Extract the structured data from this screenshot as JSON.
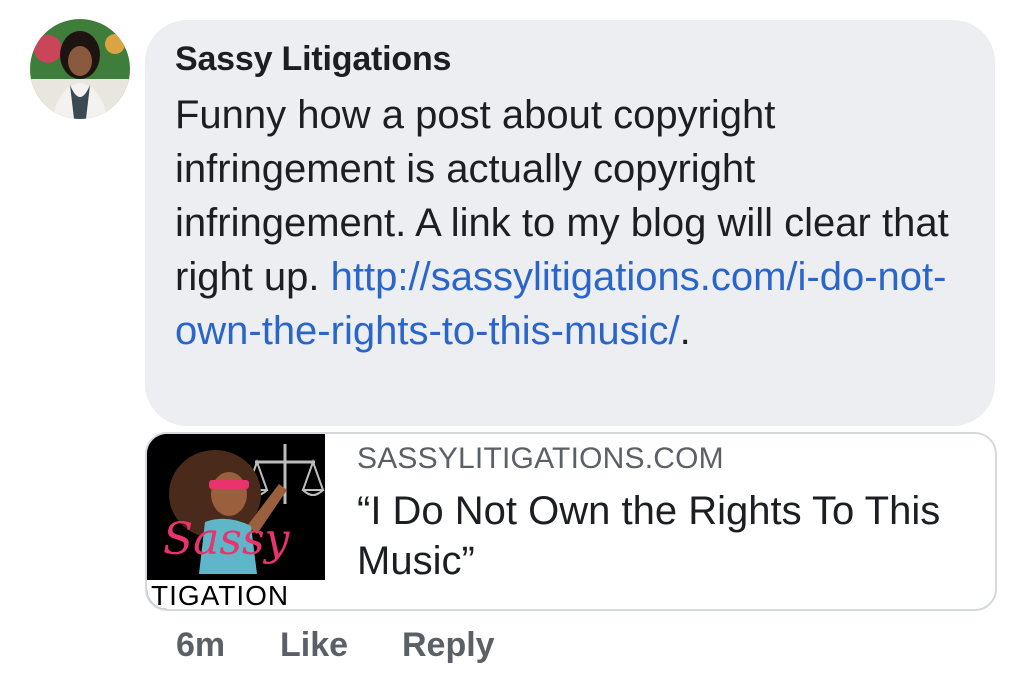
{
  "comment": {
    "author": "Sassy Litigations",
    "text": "Funny how a post about copyright infringement is actually copyright infringement. A link to my blog will clear that right up.",
    "link_text": "http://sassylitigations.com/i-do-not-own-the-rights-to-this-music/",
    "trailing_punct": "."
  },
  "link_preview": {
    "domain": "SASSYLITIGATIONS.COM",
    "title": "“I Do Not Own the Rights To This Music”",
    "thumbnail_logo_text": "Sassy",
    "thumbnail_sub_text": "TIGATION"
  },
  "actions": {
    "time": "6m",
    "like": "Like",
    "reply": "Reply"
  },
  "colors": {
    "bubble_bg": "#eceef1",
    "link": "#2a66c9",
    "meta_text": "#5b5f66",
    "brand_pink": "#e8336c"
  }
}
